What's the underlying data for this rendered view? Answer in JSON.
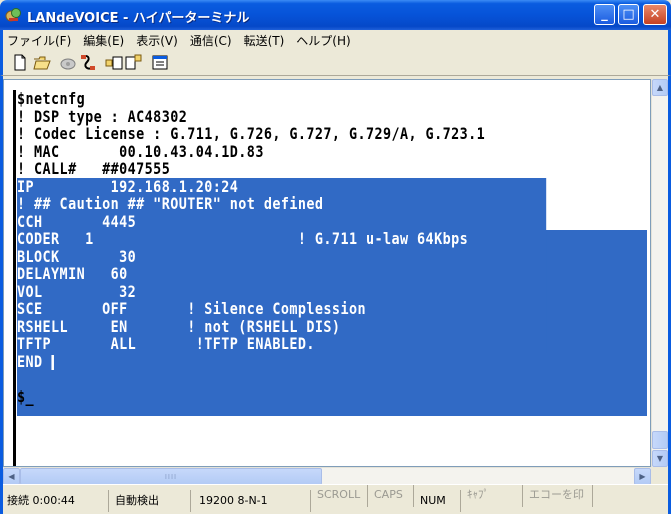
{
  "window": {
    "title": "LANdeVOICE - ハイパーターミナル",
    "minimize_glyph": "_",
    "maximize_glyph": "□",
    "close_glyph": "✕"
  },
  "menu": {
    "items": [
      {
        "label": "ファイル(F)"
      },
      {
        "label": "編集(E)"
      },
      {
        "label": "表示(V)"
      },
      {
        "label": "通信(C)"
      },
      {
        "label": "転送(T)"
      },
      {
        "label": "ヘルプ(H)"
      }
    ]
  },
  "toolbar": {
    "icons": [
      "new-file-icon",
      "open-folder-icon",
      "connect-phone-icon",
      "disconnect-phone-icon",
      "send-file-icon",
      "receive-file-icon",
      "properties-icon"
    ]
  },
  "terminal": {
    "lines_before": [
      "$netcnfg",
      "! DSP type : AC48302",
      "! Codec License : G.711, G.726, G.727, G.729/A, G.723.1",
      "! MAC       00.10.43.04.1D.83",
      "! CALL#   ##047555"
    ],
    "selected_lines": [
      "IP         192.168.1.20:24",
      "! ## Caution ## \"ROUTER\" not defined",
      "CCH       4445",
      "CODER   1                        ! G.711 u-law 64Kbps",
      "BLOCK       30",
      "DELAYMIN   60",
      "VOL         32",
      "SCE       OFF       ! Silence Complession",
      "RSHELL     EN       ! not (RSHELL DIS)",
      "TFTP       ALL       !TFTP ENABLED."
    ],
    "end_line": "END ",
    "blank_line": "",
    "prompt_line": "$_"
  },
  "scrollbars": {
    "up_glyph": "▲",
    "down_glyph": "▼",
    "left_glyph": "◀",
    "right_glyph": "▶",
    "thumb_grip": "IIII"
  },
  "status": {
    "connection": "接続 0:00:44",
    "detect": "自動検出",
    "baud": "19200 8-N-1",
    "scroll": "SCROLL",
    "caps": "CAPS",
    "num": "NUM",
    "kana": "ｷｬﾌﾟ",
    "echo": "エコーを印",
    "extra": ""
  }
}
